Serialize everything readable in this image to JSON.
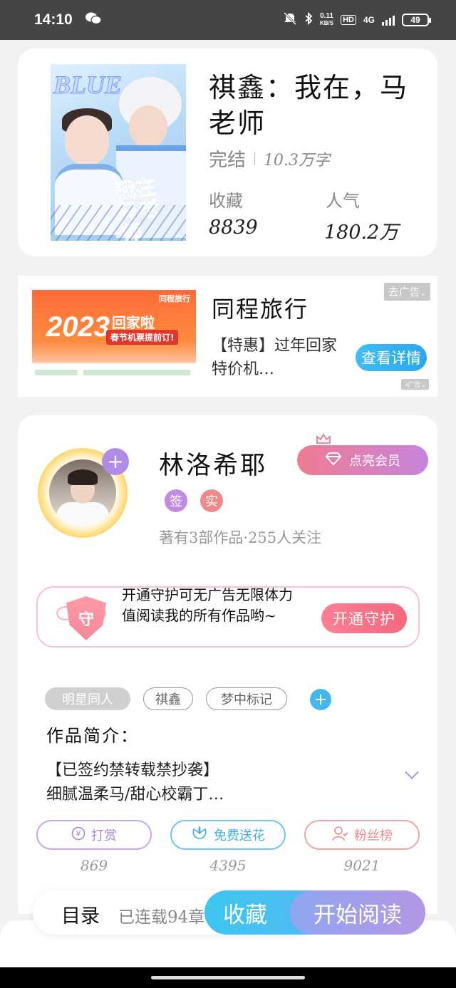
{
  "status_bar": {
    "time": "14:10",
    "wechat_icon": "wechat-icon",
    "speed_value": "0.11",
    "speed_unit": "KB/S",
    "hd": "HD",
    "network": "4G",
    "battery": "49"
  },
  "book": {
    "title": "祺鑫：我在，马老师",
    "status": "完结",
    "word_count": "10.3万字",
    "favorites_label": "收藏",
    "favorites_value": "8839",
    "popularity_label": "人气",
    "popularity_value": "180.2万",
    "cover_art_text": "BLUE",
    "cover_title": "我在马老师"
  },
  "ad": {
    "close_label": "去广告",
    "title": "同程旅行",
    "description": "【特惠】过年回家特价机…",
    "cta_label": "查看详情",
    "ad_mark": "广告",
    "image_brand": "同程旅行",
    "image_year": "2023",
    "image_headline": "回家啦",
    "image_sub": "春节机票提前订!"
  },
  "author": {
    "name": "林洛希耶",
    "badge_signed": "签",
    "badge_real": "实",
    "info": "著有3部作品·255人关注",
    "vip_label": "点亮会员",
    "follow_icon": "plus-icon"
  },
  "guard": {
    "shield_text": "守",
    "text": "开通守护可无广告无限体力值阅读我的所有作品哟~",
    "button_label": "开通守护"
  },
  "tags": [
    "明星同人",
    "祺鑫",
    "梦中标记"
  ],
  "intro": {
    "label": "作品简介：",
    "line1": "【已签约禁转载禁抄袭】",
    "line2": "细腻温柔马/甜心校霸丁…"
  },
  "actions": [
    {
      "label": "打赏",
      "count": "869",
      "icon": "coin-icon"
    },
    {
      "label": "免费送花",
      "count": "4395",
      "icon": "flower-icon"
    },
    {
      "label": "粉丝榜",
      "count": "9021",
      "icon": "fans-icon"
    }
  ],
  "bottom": {
    "toc_label": "目录",
    "toc_status": "已连载94章",
    "collect_label": "收藏",
    "read_label": "开始阅读"
  }
}
